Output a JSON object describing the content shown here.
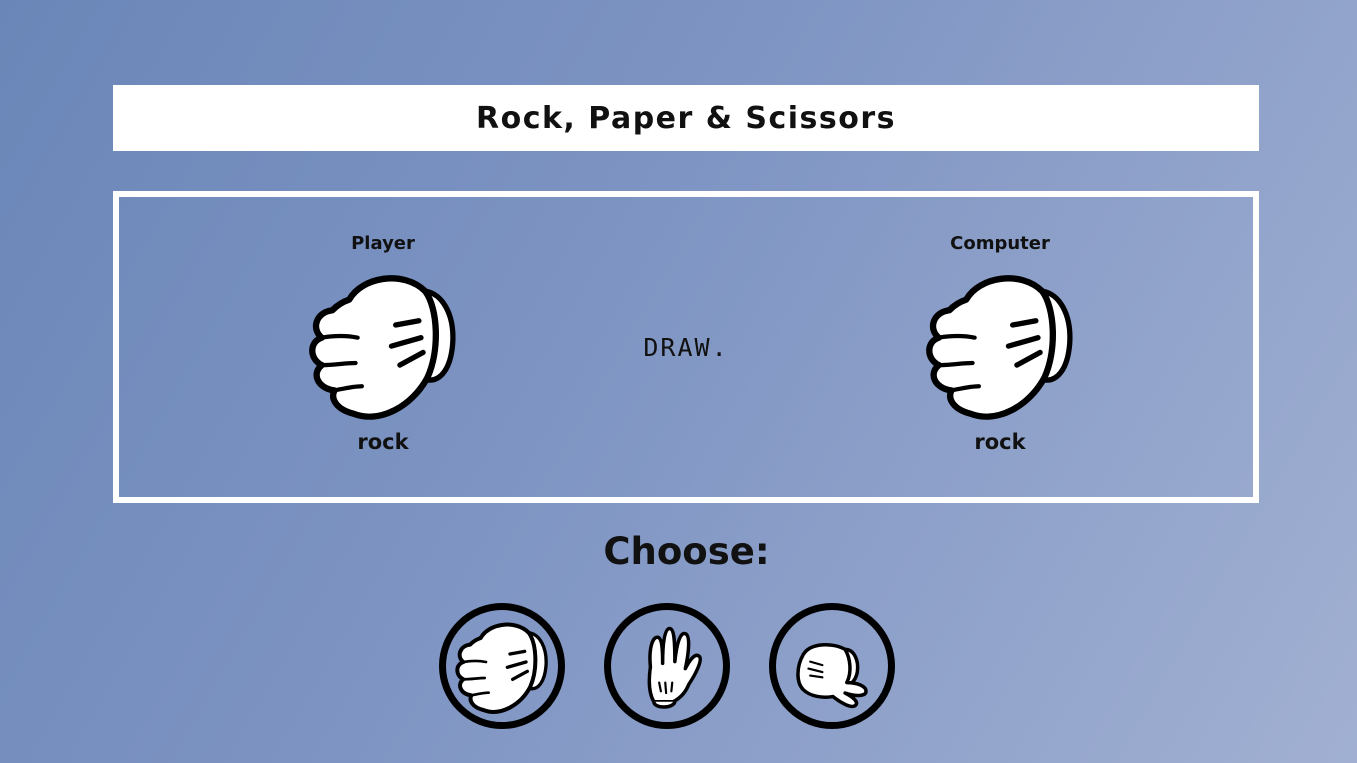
{
  "header": {
    "title": "Rock, Paper & Scissors"
  },
  "arena": {
    "player": {
      "label": "Player",
      "choice": "rock",
      "hand_icon": "rock-glove-icon"
    },
    "computer": {
      "label": "Computer",
      "choice": "rock",
      "hand_icon": "rock-glove-icon"
    },
    "result": "DRAW."
  },
  "choose": {
    "heading": "Choose:",
    "options": [
      {
        "id": "rock",
        "icon": "rock-glove-icon"
      },
      {
        "id": "paper",
        "icon": "paper-glove-icon"
      },
      {
        "id": "scissors",
        "icon": "scissors-glove-icon"
      }
    ]
  },
  "colors": {
    "background_start": "#6a86b8",
    "background_end": "#a1b0d2",
    "panel": "#ffffff",
    "text": "#111111"
  }
}
